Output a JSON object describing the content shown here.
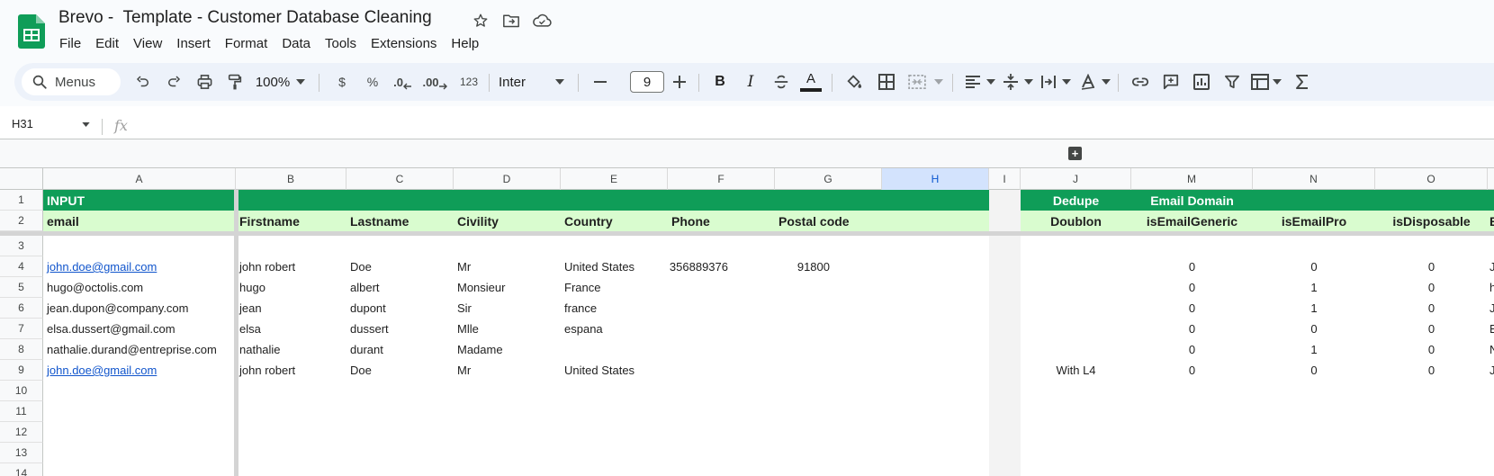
{
  "app": {
    "title": "Brevo -  Template - Customer Database Cleaning",
    "menus": [
      "File",
      "Edit",
      "View",
      "Insert",
      "Format",
      "Data",
      "Tools",
      "Extensions",
      "Help"
    ]
  },
  "toolbar": {
    "search_label": "Menus",
    "zoom": "100%",
    "currency": "$",
    "percent": "%",
    "decrease_decimal": ".0",
    "increase_decimal": ".00",
    "number_format": "123",
    "font": "Inter",
    "font_size": "9",
    "bold": "B",
    "italic": "I",
    "text_color_glyph": "A"
  },
  "formula_bar": {
    "name_box": "H31",
    "fx": "fx",
    "value": ""
  },
  "grid": {
    "columns": [
      "A",
      "B",
      "C",
      "D",
      "E",
      "F",
      "G",
      "H",
      "I",
      "J",
      "M",
      "N",
      "O"
    ],
    "selected_column": "H",
    "row_numbers": [
      "1",
      "2",
      "3",
      "4",
      "5",
      "6",
      "7",
      "8",
      "9",
      "10",
      "11",
      "12",
      "13",
      "14"
    ],
    "row1": {
      "A": "INPUT",
      "J": "Dedupe",
      "M": "Email Domain"
    },
    "row2": {
      "A": "email",
      "B": "Firstname",
      "C": "Lastname",
      "D": "Civility",
      "E": "Country",
      "F": "Phone",
      "G": "Postal code",
      "J": "Doublon",
      "M": "isEmailGeneric",
      "N": "isEmailPro",
      "O": "isDisposable",
      "P": "E"
    },
    "data_rows": [
      {
        "A": "john.doe@gmail.com",
        "A_link": true,
        "B": "john robert",
        "C": "Doe",
        "D": "Mr",
        "E": "United States",
        "F": "356889376",
        "G": "91800",
        "J": "",
        "M": "0",
        "N": "0",
        "O": "0",
        "P": "J"
      },
      {
        "A": "hugo@octolis.com",
        "A_link": false,
        "B": "hugo",
        "C": "albert",
        "D": "Monsieur",
        "E": "France",
        "F": "",
        "G": "",
        "J": "",
        "M": "0",
        "N": "1",
        "O": "0",
        "P": "h"
      },
      {
        "A": "jean.dupon@company.com",
        "A_link": false,
        "B": "jean",
        "C": "dupont",
        "D": "Sir",
        "E": "france",
        "F": "",
        "G": "",
        "J": "",
        "M": "0",
        "N": "1",
        "O": "0",
        "P": "J"
      },
      {
        "A": "elsa.dussert@gmail.com",
        "A_link": false,
        "B": "elsa",
        "C": "dussert",
        "D": "Mlle",
        "E": "espana",
        "F": "",
        "G": "",
        "J": "",
        "M": "0",
        "N": "0",
        "O": "0",
        "P": "E"
      },
      {
        "A": "nathalie.durand@entreprise.com",
        "A_link": false,
        "B": "nathalie",
        "C": "durant",
        "D": "Madame",
        "E": "",
        "F": "",
        "G": "",
        "J": "",
        "M": "0",
        "N": "1",
        "O": "0",
        "P": "N"
      },
      {
        "A": "john.doe@gmail.com",
        "A_link": true,
        "B": "john robert",
        "C": "Doe",
        "D": "Mr",
        "E": "United States",
        "F": "",
        "G": "",
        "J": "With L4",
        "M": "0",
        "N": "0",
        "O": "0",
        "P": "J"
      }
    ]
  },
  "colors": {
    "header_green": "#0f9d58",
    "subheader_green": "#d9fccf",
    "selected_col": "#d3e3fd",
    "link": "#1155cc"
  }
}
